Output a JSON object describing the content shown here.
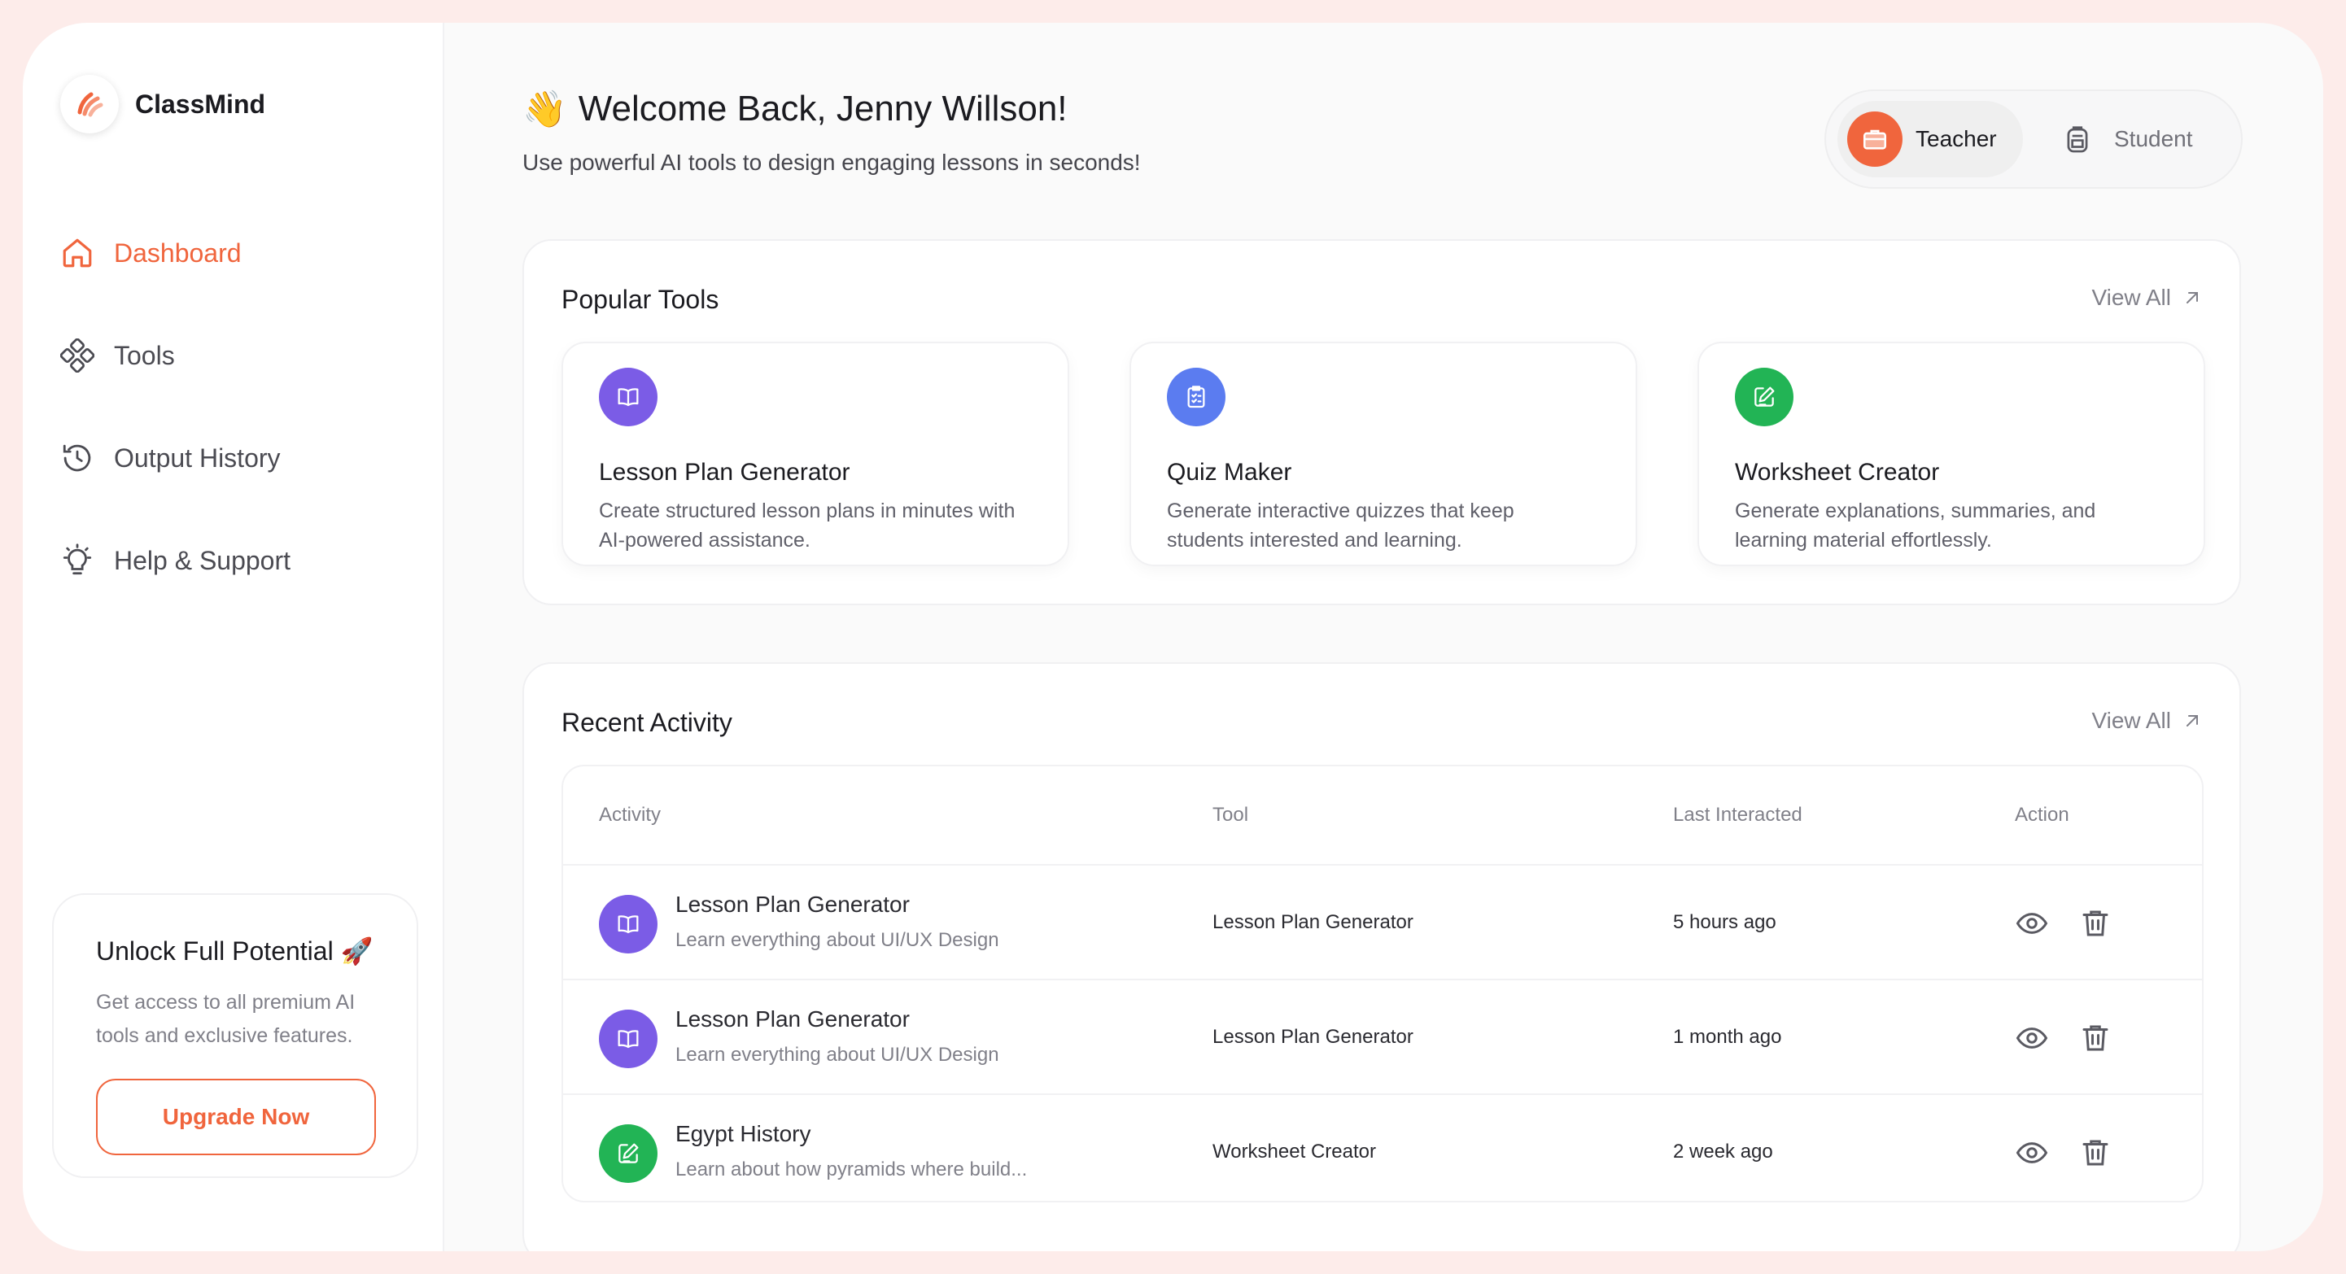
{
  "app": {
    "name": "ClassMind"
  },
  "sidebar": {
    "items": [
      {
        "label": "Dashboard",
        "icon": "home-icon",
        "active": true
      },
      {
        "label": "Tools",
        "icon": "tools-icon"
      },
      {
        "label": "Output History",
        "icon": "history-icon"
      },
      {
        "label": "Help & Support",
        "icon": "lightbulb-icon"
      }
    ],
    "upgrade": {
      "title": "Unlock Full Potential 🚀",
      "description_line1": "Get access to all premium AI",
      "description_line2": "tools and exclusive features.",
      "button": "Upgrade Now"
    }
  },
  "header": {
    "wave": "👋",
    "title": "Welcome Back, Jenny Willson!",
    "subtitle": "Use powerful AI tools to design engaging lessons in seconds!",
    "roles": {
      "teacher": "Teacher",
      "student": "Student",
      "selected": "Teacher"
    }
  },
  "popular_tools": {
    "title": "Popular Tools",
    "view_all": "View All",
    "tools": [
      {
        "name": "Lesson Plan Generator",
        "desc_line1": "Create structured lesson plans in minutes with",
        "desc_line2": "AI-powered assistance.",
        "icon": "book-icon",
        "color": "#7b5ce6"
      },
      {
        "name": "Quiz Maker",
        "desc_line1": "Generate interactive quizzes that keep",
        "desc_line2": "students interested and learning.",
        "icon": "clipboard-icon",
        "color": "#5b7cf0"
      },
      {
        "name": "Worksheet Creator",
        "desc_line1": "Generate explanations, summaries, and",
        "desc_line2": "learning material effortlessly.",
        "icon": "edit-icon",
        "color": "#22b455"
      }
    ]
  },
  "recent_activity": {
    "title": "Recent Activity",
    "view_all": "View All",
    "columns": [
      "Activity",
      "Tool",
      "Last Interacted",
      "Action"
    ],
    "rows": [
      {
        "title": "Lesson Plan Generator",
        "subtitle": "Learn everything about UI/UX Design",
        "tool": "Lesson Plan Generator",
        "last": "5 hours ago",
        "icon": "book-icon",
        "color": "#7b5ce6"
      },
      {
        "title": "Lesson Plan Generator",
        "subtitle": "Learn everything about UI/UX Design",
        "tool": "Lesson Plan Generator",
        "last": "1 month ago",
        "icon": "book-icon",
        "color": "#7b5ce6"
      },
      {
        "title": "Egypt History",
        "subtitle": "Learn about how pyramids where build...",
        "tool": "Worksheet Creator",
        "last": "2 week ago",
        "icon": "edit-icon",
        "color": "#22b455"
      }
    ]
  },
  "colors": {
    "accent": "#f0653d",
    "purple": "#7b5ce6",
    "blue": "#5b7cf0",
    "green": "#22b455"
  }
}
